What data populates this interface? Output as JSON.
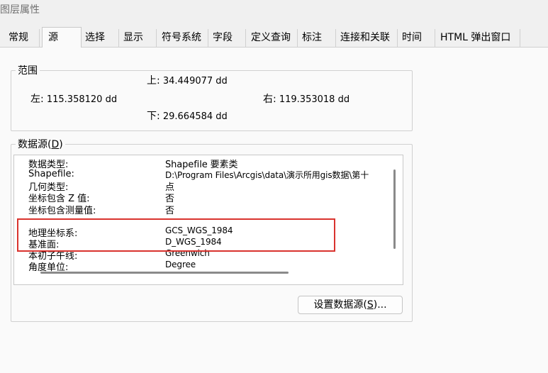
{
  "window": {
    "title": "图层属性"
  },
  "tabs": [
    {
      "label": "常规",
      "active": false
    },
    {
      "label": "源",
      "active": true
    },
    {
      "label": "选择",
      "active": false
    },
    {
      "label": "显示",
      "active": false
    },
    {
      "label": "符号系统",
      "active": false
    },
    {
      "label": "字段",
      "active": false
    },
    {
      "label": "定义查询",
      "active": false
    },
    {
      "label": "标注",
      "active": false
    },
    {
      "label": "连接和关联",
      "active": false
    },
    {
      "label": "时间",
      "active": false
    },
    {
      "label": "HTML 弹出窗口",
      "active": false
    }
  ],
  "extent": {
    "legend": "范围",
    "top_label": "上:",
    "top_value": "34.449077 dd",
    "left_label": "左:",
    "left_value": "115.358120 dd",
    "right_label": "右:",
    "right_value": "119.353018 dd",
    "bottom_label": "下:",
    "bottom_value": "29.664584 dd"
  },
  "datasource": {
    "legend_text": "数据源(",
    "legend_key": "D",
    "legend_end": ")",
    "rows": [
      {
        "label": "数据类型:",
        "value": "Shapefile 要素类"
      },
      {
        "label": "Shapefile:",
        "value": "D:\\Program Files\\Arcgis\\data\\演示所用gis数据\\第十"
      },
      {
        "label": "几何类型:",
        "value": "点"
      },
      {
        "label": "坐标包含 Z 值:",
        "value": "否"
      },
      {
        "label": "坐标包含测量值:",
        "value": "否"
      },
      {
        "label": "",
        "value": ""
      },
      {
        "label": "地理坐标系:",
        "value": "GCS_WGS_1984"
      },
      {
        "label": "基准面:",
        "value": "D_WGS_1984"
      },
      {
        "label": "本初子午线:",
        "value": "Greenwich"
      },
      {
        "label": "角度单位:",
        "value": "Degree"
      }
    ]
  },
  "buttons": {
    "set_source_text": "设置数据源(",
    "set_source_key": "S",
    "set_source_end": ")..."
  }
}
